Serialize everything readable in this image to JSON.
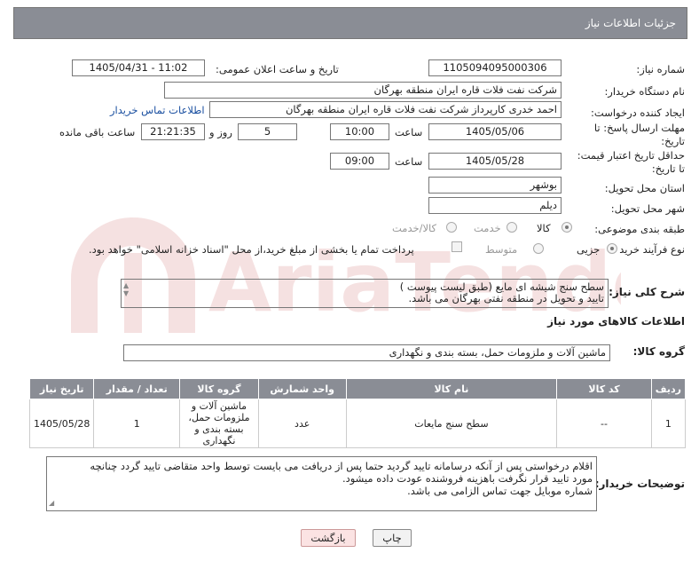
{
  "header": {
    "title": "جزئیات اطلاعات نیاز"
  },
  "form": {
    "need_number_label": "شماره نیاز:",
    "need_number": "1105094095000306",
    "announce_label": "تاریخ و ساعت اعلان عمومی:",
    "announce_value": "1405/04/31 - 11:02",
    "buyer_org_label": "نام دستگاه خریدار:",
    "buyer_org": "شرکت نفت فلات قاره ایران منطقه بهرگان",
    "creator_label": "ایجاد کننده درخواست:",
    "creator": "احمد خدری کارپرداز شرکت نفت فلات قاره ایران منطقه بهرگان",
    "contact_link": "اطلاعات تماس خریدار",
    "deadline_label_1": "مهلت ارسال پاسخ: تا",
    "deadline_label_2": "تاریخ:",
    "deadline_date": "1405/05/06",
    "time_label": "ساعت",
    "deadline_time": "10:00",
    "days_value": "5",
    "days_label": "روز و",
    "remaining_value": "21:21:35",
    "remaining_label": "ساعت باقی مانده",
    "price_label_1": "حداقل تاریخ اعتبار قیمت:",
    "price_label_2": "تا تاریخ:",
    "price_date": "1405/05/28",
    "price_time_label": "ساعت",
    "price_time": "09:00",
    "province_label": "استان محل تحویل:",
    "province": "بوشهر",
    "city_label": "شهر محل تحویل:",
    "city": "دیلم",
    "category_label": "طبقه بندی موضوعی:",
    "category_options": [
      "کالا",
      "خدمت",
      "کالا/خدمت"
    ],
    "process_label": "نوع فرآیند خرید :",
    "process_options": [
      "جزیی",
      "متوسط"
    ],
    "payment_note": "پرداخت تمام یا بخشی از مبلغ خرید،از محل \"اسناد خزانه اسلامی\" خواهد بود."
  },
  "description": {
    "label": "شرح کلی نیاز:",
    "line1": "سطح سنج شیشه ای مایع (طبق لیست پیوست )",
    "line2": "تایید و تحویل در منطقه نفتی بهرگان می باشد."
  },
  "goods": {
    "section_title": "اطلاعات کالاهای مورد نیاز",
    "group_label": "گروه کالا:",
    "group_value": "ماشین آلات و ملزومات حمل، بسته بندی و نگهداری"
  },
  "table": {
    "headers": [
      "ردیف",
      "کد کالا",
      "نام کالا",
      "واحد شمارش",
      "گروه کالا",
      "تعداد / مقدار",
      "تاریخ نیاز"
    ],
    "rows": [
      {
        "row": "1",
        "code": "--",
        "name": "سطح سنج مایعات",
        "unit": "عدد",
        "group": "ماشین آلات و ملزومات حمل، بسته بندی و نگهداری",
        "qty": "1",
        "date": "1405/05/28"
      }
    ]
  },
  "buyer_notes": {
    "label": "توضیحات خریدار:",
    "line1": "اقلام درخواستی پس از آنکه درسامانه تایید گردید حتما پس از دریافت می بایست توسط واحد متقاضی تایید گردد چنانچه",
    "line2": "مورد تایید قرار نگرفت باهزینه فروشنده عودت داده میشود.",
    "line3": "شماره موبایل جهت تماس الزامی می باشد."
  },
  "buttons": {
    "print": "چاپ",
    "back": "بازگشت"
  },
  "watermark": {
    "text": "AriaTender.net"
  }
}
